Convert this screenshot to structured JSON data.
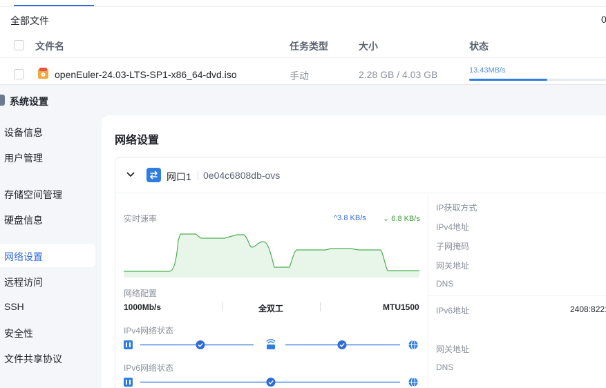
{
  "file_manager": {
    "title": "全部文件",
    "count": "0",
    "columns": {
      "name": "文件名",
      "task_type": "任务类型",
      "size": "大小",
      "status": "状态"
    },
    "row": {
      "file_name": "openEuler-24.03-LTS-SP1-x86_64-dvd.iso",
      "task_type": "手动",
      "size": "2.28 GB / 4.03 GB",
      "speed": "13.43MB/s",
      "progress_fraction": 0.57
    }
  },
  "settings": {
    "window_title": "系统设置",
    "nav": [
      {
        "label": "设备信息",
        "active": false
      },
      {
        "label": "用户管理",
        "active": false
      },
      {
        "label": "存储空间管理",
        "active": false
      },
      {
        "label": "硬盘信息",
        "active": false
      },
      {
        "label": "网络设置",
        "active": true
      },
      {
        "label": "远程访问",
        "active": false
      },
      {
        "label": "SSH",
        "active": false
      },
      {
        "label": "安全性",
        "active": false
      },
      {
        "label": "文件共享协议",
        "active": false
      }
    ],
    "panel_title": "网络设置",
    "port": {
      "name": "网口1",
      "id": "0e04c6808db-ovs",
      "realtime_label": "实时速率",
      "upload_rate": "3.8 KB/s",
      "download_rate": "6.8 KB/s",
      "config_label": "网络配置",
      "speed": "1000Mb/s",
      "duplex": "全双工",
      "mtu": "MTU1500",
      "ipv4_status_label": "IPv4网络状态",
      "ipv6_status_label": "IPv6网络状态",
      "right": {
        "ip_method_label": "IP获取方式",
        "ipv4_label": "IPv4地址",
        "subnet_label": "子网掩码",
        "gateway_label": "网关地址",
        "dns_label": "DNS",
        "ipv6_label": "IPv6地址",
        "ipv6_value": "2408:8221",
        "gateway6_label": "网关地址",
        "dns6_label": "DNS"
      }
    },
    "colors": {
      "accent": "#2f7de1",
      "chart_line": "#4caf50",
      "chart_fill": "#e8f5e9"
    }
  }
}
